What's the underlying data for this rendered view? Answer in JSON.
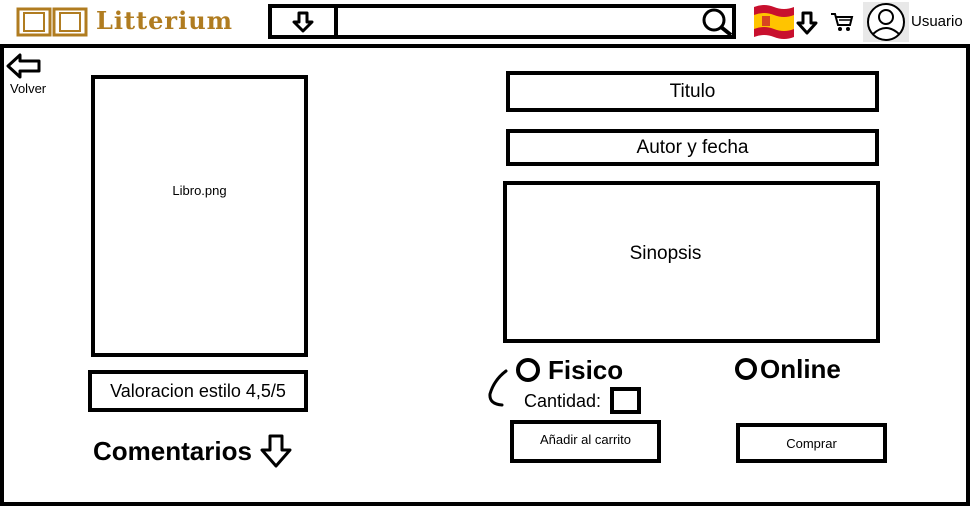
{
  "header": {
    "logo_text": "Litterium",
    "search_placeholder": "",
    "user_label": "Usuario",
    "icons": [
      "book-logo-icon",
      "dropdown-arrow-icon",
      "search-icon",
      "spain-flag-icon",
      "cart-icon",
      "user-avatar-icon"
    ]
  },
  "nav": {
    "back_label": "Volver"
  },
  "book": {
    "image_label": "Libro.png",
    "rating_label": "Valoracion estilo 4,5/5",
    "comments_label": "Comentarios"
  },
  "details": {
    "title_label": "Titulo",
    "author_date_label": "Autor y fecha",
    "synopsis_label": "Sinopsis"
  },
  "purchase": {
    "physical_label": "Fisico",
    "online_label": "Online",
    "quantity_label": "Cantidad:",
    "add_to_cart_label": "Añadir al carrito",
    "buy_label": "Comprar"
  },
  "colors": {
    "logo": "#b07c20",
    "flag_red": "#c8102e",
    "flag_yellow": "#ffc400"
  }
}
